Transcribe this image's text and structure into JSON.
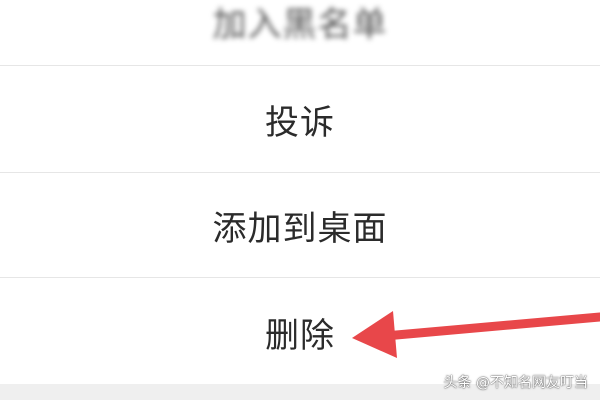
{
  "menu": {
    "items": [
      {
        "label": "加入黑名单"
      },
      {
        "label": "投诉"
      },
      {
        "label": "添加到桌面"
      },
      {
        "label": "删除"
      }
    ]
  },
  "annotation": {
    "arrow_color": "#e8474a",
    "target": "删除"
  },
  "watermark": "头条 @不知名网友叮当"
}
